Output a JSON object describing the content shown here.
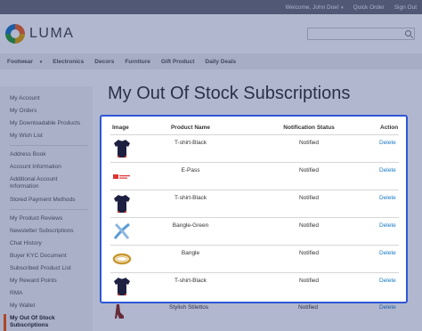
{
  "topbar": {
    "welcome": "Welcome, John Doe!",
    "quick_order": "Quick Order",
    "sign_out": "Sign Out"
  },
  "header": {
    "logo_text": "LUMA",
    "search_placeholder": ""
  },
  "nav": {
    "items": [
      "Footwear",
      "Electronics",
      "Decors",
      "Furniture",
      "Gift Product",
      "Daily Deals"
    ]
  },
  "sidebar": {
    "group1": [
      "My Account",
      "My Orders",
      "My Downloadable Products",
      "My Wish List"
    ],
    "group2": [
      "Address Book",
      "Account Information",
      "Additional Account Information",
      "Stored Payment Methods"
    ],
    "group3": [
      "My Product Reviews",
      "Newsletter Subscriptions",
      "Chat History",
      "Buyer KYC Document",
      "Subscribed Product List",
      "My Reward Points",
      "RMA",
      "My Wallet",
      "My Out Of Stock Subscriptions"
    ]
  },
  "page": {
    "title": "My Out Of Stock Subscriptions"
  },
  "table": {
    "headers": {
      "image": "Image",
      "product_name": "Product Name",
      "notification_status": "Notification Status",
      "action": "Action"
    },
    "rows": [
      {
        "image": "tshirt-black",
        "name": "T-shirt-Black",
        "status": "Notified",
        "action": "Delete"
      },
      {
        "image": "epass-logo",
        "name": "E-Pass",
        "status": "Notified",
        "action": "Delete"
      },
      {
        "image": "tshirt-black",
        "name": "T-shirt-Black",
        "status": "Notified",
        "action": "Delete"
      },
      {
        "image": "bangle-green",
        "name": "Bangle-Green",
        "status": "Notified",
        "action": "Delete"
      },
      {
        "image": "bangle",
        "name": "Bangle",
        "status": "Notified",
        "action": "Delete"
      },
      {
        "image": "tshirt-black",
        "name": "T-shirt-Black",
        "status": "Notified",
        "action": "Delete"
      }
    ],
    "row_under": {
      "name": "Stylish Stilettos",
      "status": "Notified",
      "action": "Delete"
    }
  },
  "colors": {
    "accent": "#2d56d6",
    "link": "#1979c3",
    "active_marker": "#ff5501",
    "overlay": "#192d6e"
  }
}
